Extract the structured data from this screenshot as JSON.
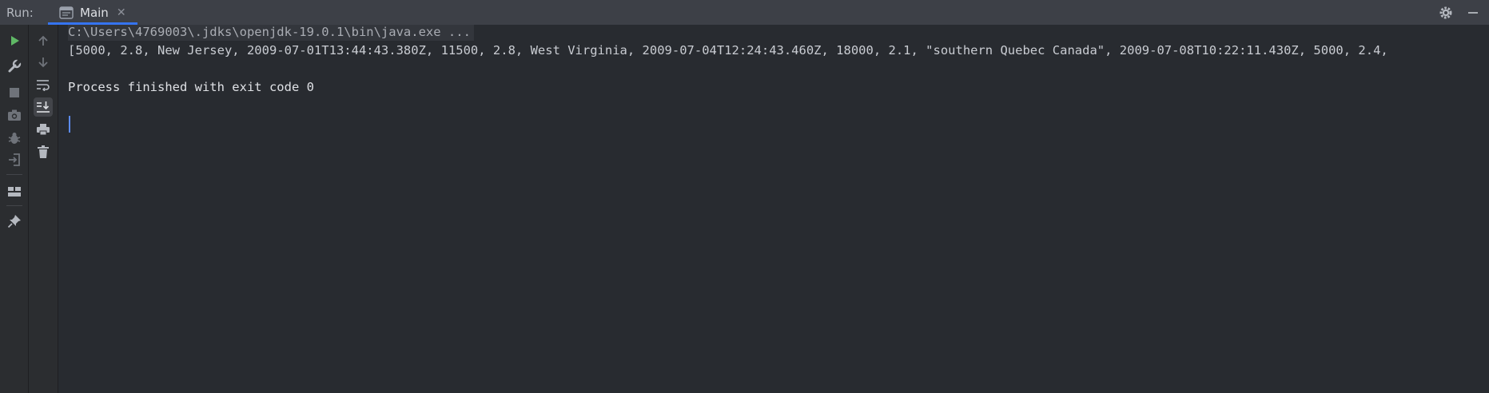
{
  "run_panel": {
    "label": "Run:",
    "tab": {
      "label": "Main",
      "icon": "console-window-icon",
      "close": "✕"
    },
    "right_icons": [
      "gear-icon",
      "minimize-icon"
    ]
  },
  "left_toolbar": [
    "rerun-icon",
    "wrench-icon",
    "stop-icon",
    "camera-icon",
    "bug-icon",
    "login-icon",
    "layout-icon",
    "pin-icon"
  ],
  "console_toolbar": [
    "arrow-up-icon",
    "arrow-down-icon",
    "soft-wrap-icon",
    "scroll-to-end-icon",
    "print-icon",
    "trash-icon"
  ],
  "console": {
    "command": "C:\\Users\\4769003\\.jdks\\openjdk-19.0.1\\bin\\java.exe ...",
    "output": "[5000, 2.8, New Jersey, 2009-07-01T13:44:43.380Z, 11500, 2.8, West Virginia, 2009-07-04T12:24:43.460Z, 18000, 2.1, \"southern Quebec Canada\", 2009-07-08T10:22:11.430Z, 5000, 2.4,",
    "finished": "Process finished with exit code 0"
  },
  "colors": {
    "accent": "#3574f0",
    "run_green": "#5fb865"
  }
}
